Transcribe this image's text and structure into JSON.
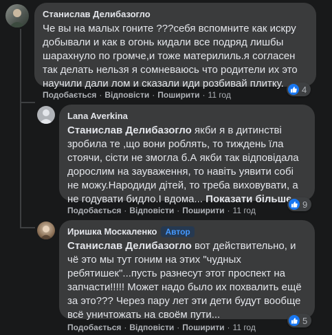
{
  "comments": [
    {
      "author": "Станислав Делибазогло",
      "text": "Че вы на малых гоните ???себя вспомните как искру добывали и как в огонь кидали все подряд лишбы шарахнуло по громче,и тоже материлиль.я согласен так делать нельзя я сомневаюсь что родители их это научили дали лом и сказали иди розбивай плитку.",
      "actions": [
        "Подобається",
        "Відповісти",
        "Поширити"
      ],
      "time": "11 год",
      "reactions": "4"
    },
    {
      "author": "Lana Averkina",
      "mention": "Станислав Делибазогло",
      "text": " якби я в дитинстві зробила те ,що вони роблять, то тиждень їла стоячи, сісти не змогла б.А якби так відповідала дорослим на зауваження, то навіть уявити собі не можу.Народиди дітей, то треба виховувати, а не годувати бидло.І вдома...",
      "more": "Показати більше",
      "actions": [
        "Подобається",
        "Відповісти",
        "Поширити"
      ],
      "time": "11 год",
      "reactions": "9"
    },
    {
      "author": "Иришка Москаленко",
      "badge": "Автор",
      "mention": "Станислав Делибазогло",
      "text": " вот действительно, и чё это мы тут гоним на этих \"чудных ребятишек\"...пусть разнесут этот проспект на запчасти!!!!! Может надо было их похвалить ещё за это??? Через пару лет эти дети будут вообще всё уничтожать на своём пути...",
      "actions": [
        "Подобається",
        "Відповісти",
        "Поширити"
      ],
      "time": "11 год",
      "reactions": "5"
    }
  ],
  "colors": {
    "background": "#18191a",
    "bubble": "#3a3b3c",
    "like_blue": "#1877f2",
    "author_badge": "#4599ff"
  },
  "icons": [
    "like-icon",
    "avatar-placeholder-icon"
  ]
}
